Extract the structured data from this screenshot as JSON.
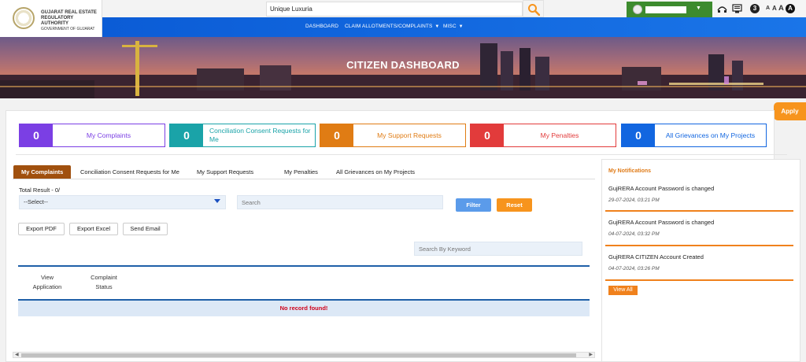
{
  "header": {
    "logo_line1": "GUJARAT REAL ESTATE",
    "logo_line2": "REGULATORY AUTHORITY",
    "logo_line3": "GOVERNMENT OF GUJARAT",
    "search_value": "Unique Luxuria",
    "lang_badge": "3",
    "font_small": "A",
    "font_medium": "A",
    "font_large": "A",
    "font_contrast": "A"
  },
  "nav": {
    "items": [
      {
        "label": "DASHBOARD",
        "has_dropdown": false
      },
      {
        "label": "CLAIM ALLOTMENTS/COMPLAINTS",
        "has_dropdown": true
      },
      {
        "label": "MISC",
        "has_dropdown": true
      }
    ]
  },
  "banner": {
    "title": "CITIZEN DASHBOARD"
  },
  "apply_tab": "Apply",
  "stats": [
    {
      "count": "0",
      "label": "My Complaints",
      "color": "#7b3fe4"
    },
    {
      "count": "0",
      "label": "Conciliation Consent Requests for Me",
      "color": "#1aa3a8"
    },
    {
      "count": "0",
      "label": "My Support Requests",
      "color": "#e07c14"
    },
    {
      "count": "0",
      "label": "My Penalties",
      "color": "#e23b3b"
    },
    {
      "count": "0",
      "label": "All Grievances on My Projects",
      "color": "#1266e0"
    }
  ],
  "tabs": [
    {
      "label": "My Complaints",
      "active": true
    },
    {
      "label": "Conciliation Consent Requests for Me",
      "active": false
    },
    {
      "label": "My Support Requests",
      "active": false
    },
    {
      "label": "My Penalties",
      "active": false
    },
    {
      "label": "All Grievances on My Projects",
      "active": false
    }
  ],
  "filters": {
    "total_result": "Total Result - 0/",
    "select_value": "--Select--",
    "search_placeholder": "Search",
    "filter_label": "Filter",
    "reset_label": "Reset"
  },
  "export": {
    "pdf": "Export PDF",
    "excel": "Export Excel",
    "email": "Send Email",
    "keyword_placeholder": "Search By Keyword"
  },
  "table": {
    "columns": [
      {
        "line1": "View",
        "line2": "Application"
      },
      {
        "line1": "Complaint",
        "line2": "Status"
      }
    ],
    "empty_message": "No record found!"
  },
  "notifications": {
    "title": "My Notifications",
    "items": [
      {
        "text": "GujRERA Account Password is changed",
        "date": "29-07-2024, 03:21 PM"
      },
      {
        "text": "GujRERA Account Password is changed",
        "date": "04-07-2024, 03:32 PM"
      },
      {
        "text": "GujRERA CITIZEN Account Created",
        "date": "04-07-2024, 03:26 PM"
      }
    ],
    "view_all": "View All"
  }
}
